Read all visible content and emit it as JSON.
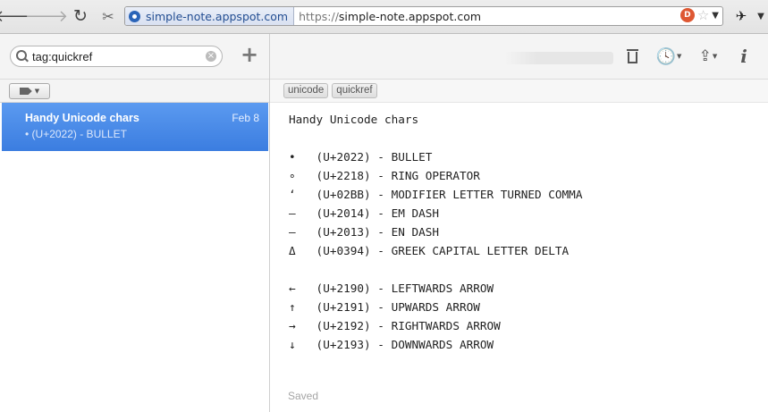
{
  "browser": {
    "icons": {
      "back": "back-arrow-icon",
      "forward": "forward-arrow-icon",
      "reload": "reload-icon",
      "extension": "extension-icon",
      "pin": "pin-icon"
    },
    "site_domain": "simple-note.appspot.com",
    "url_protocol": "https://",
    "url_host": "simple-note.appspot.com",
    "ddg_label": "D"
  },
  "sidebar": {
    "search": {
      "value": "tag:quickref"
    },
    "add_label": "+",
    "notes": [
      {
        "title": "Handy Unicode chars",
        "date": "Feb 8",
        "preview": "• (U+2022) - BULLET"
      }
    ]
  },
  "editor": {
    "tags": [
      "unicode",
      "quickref"
    ],
    "lines": [
      "Handy Unicode chars",
      "",
      "•   (U+2022) - BULLET",
      "∘   (U+2218) - RING OPERATOR",
      "ʻ   (U+02BB) - MODIFIER LETTER TURNED COMMA",
      "—   (U+2014) - EM DASH",
      "–   (U+2013) - EN DASH",
      "Δ   (U+0394) - GREEK CAPITAL LETTER DELTA",
      "",
      "←   (U+2190) - LEFTWARDS ARROW",
      "↑   (U+2191) - UPWARDS ARROW",
      "→   (U+2192) - RIGHTWARDS ARROW",
      "↓   (U+2193) - DOWNWARDS ARROW"
    ],
    "status": "Saved",
    "info_label": "i"
  },
  "colors": {
    "selected_note": "#4a8ae8",
    "accent": "#2a64b8"
  }
}
